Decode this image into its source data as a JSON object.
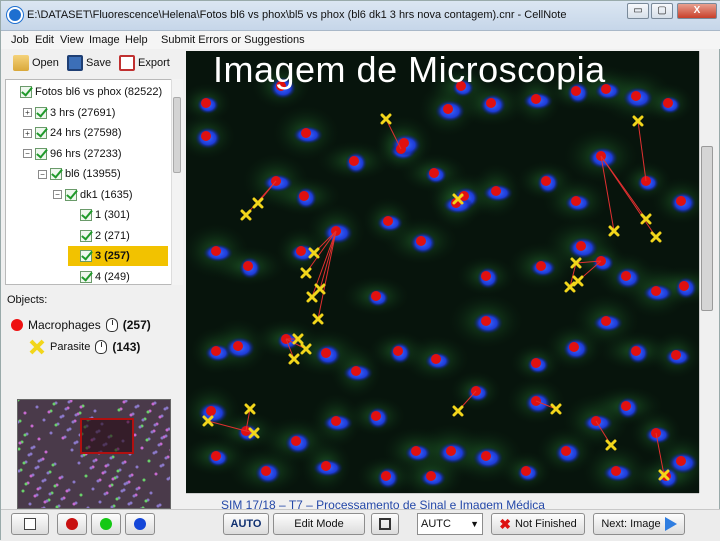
{
  "window": {
    "title": "E:\\DATASET\\Fluorescence\\Helena\\Fotos bl6 vs phox\\bl5 vs phox (bl6 dk1 3 hrs nova contagem).cnr  - CellNote",
    "min": "▭",
    "max": "▢",
    "close": "X"
  },
  "menu": [
    "Job",
    "Edit",
    "View",
    "Image",
    "Help",
    "Submit Errors or Suggestions"
  ],
  "toolbar": {
    "open": "Open",
    "save": "Save",
    "export": "Export"
  },
  "tree": [
    {
      "label": "Fotos bl6 vs phox",
      "count": "(82522)",
      "level": 0,
      "exp": "",
      "selected": false
    },
    {
      "label": "3 hrs",
      "count": "(27691)",
      "level": 1,
      "exp": "+",
      "selected": false
    },
    {
      "label": "24 hrs",
      "count": "(27598)",
      "level": 1,
      "exp": "+",
      "selected": false
    },
    {
      "label": "96 hrs",
      "count": "(27233)",
      "level": 1,
      "exp": "−",
      "selected": false
    },
    {
      "label": "bl6",
      "count": "(13955)",
      "level": 2,
      "exp": "−",
      "selected": false
    },
    {
      "label": "dk1",
      "count": "(1635)",
      "level": 3,
      "exp": "−",
      "selected": false
    },
    {
      "label": "1",
      "count": "(301)",
      "level": 4,
      "exp": "",
      "selected": false
    },
    {
      "label": "2",
      "count": "(271)",
      "level": 4,
      "exp": "",
      "selected": false
    },
    {
      "label": "3",
      "count": "(257)",
      "level": 4,
      "exp": "",
      "selected": true
    },
    {
      "label": "4",
      "count": "(249)",
      "level": 4,
      "exp": "",
      "selected": false
    }
  ],
  "objects": {
    "label": "Objects:",
    "items": [
      {
        "name": "Macrophages",
        "count": "(257)",
        "marker": "red-dot"
      },
      {
        "name": "Parasite",
        "count": "(143)",
        "marker": "yellow-x"
      }
    ]
  },
  "overlay_title": "Imagem de Microscopia",
  "footer_caption": "SIM 17/18 – T7 – Processamento de Sinal e Imagem Médica",
  "bottom": {
    "auto": "AUTO",
    "edit_mode": "Edit Mode",
    "autc_value": "AUTC",
    "not_finished": "Not Finished",
    "next_image": "Next: Image"
  },
  "colors": {
    "macrophage": "#e01010",
    "parasite": "#f2d61b",
    "nucleus": "#1d3bd8",
    "cytoplasm": "#2f8f3a",
    "selection": "#f2c200"
  }
}
